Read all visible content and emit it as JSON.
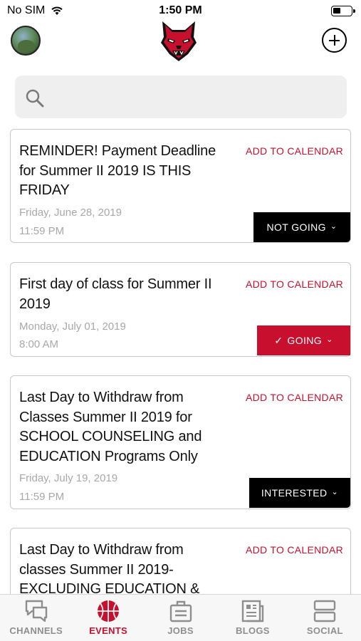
{
  "status_bar": {
    "carrier": "No SIM",
    "time": "1:50 PM",
    "battery_level": 0.45
  },
  "search": {
    "placeholder": ""
  },
  "events": [
    {
      "title": "REMINDER! Payment Deadline for Summer II 2019 IS THIS FRIDAY",
      "add_to_calendar": "ADD TO CALENDAR",
      "date": "Friday, June 28, 2019",
      "time": "11:59 PM",
      "rsvp": "NOT GOING",
      "rsvp_icon": "",
      "rsvp_style": "dark"
    },
    {
      "title": "First day of class for Summer II 2019",
      "add_to_calendar": "ADD TO CALENDAR",
      "date": "Monday, July 01, 2019",
      "time": "8:00 AM",
      "rsvp": "GOING",
      "rsvp_icon": "✓",
      "rsvp_style": "red"
    },
    {
      "title": "Last Day to Withdraw from Classes Summer II 2019 for SCHOOL COUNSELING and EDUCATION Programs Only",
      "add_to_calendar": "ADD TO CALENDAR",
      "date": "Friday, July 19, 2019",
      "time": "11:59 PM",
      "rsvp": "INTERESTED",
      "rsvp_icon": "",
      "rsvp_style": "dark"
    },
    {
      "title": "Last Day to Withdraw from classes Summer II 2019- EXCLUDING EDUCATION &",
      "add_to_calendar": "ADD TO CALENDAR"
    }
  ],
  "tabs": [
    {
      "label": "CHANNELS",
      "icon": "chat-bubbles-icon",
      "active": false
    },
    {
      "label": "EVENTS",
      "icon": "basketball-icon",
      "active": true
    },
    {
      "label": "JOBS",
      "icon": "briefcase-icon",
      "active": false
    },
    {
      "label": "BLOGS",
      "icon": "newspaper-icon",
      "active": false
    },
    {
      "label": "SOCIAL",
      "icon": "social-stack-icon",
      "active": false
    }
  ],
  "colors": {
    "accent": "#c8102e",
    "dark_button": "#000000",
    "muted_text": "#a8a8a8"
  }
}
